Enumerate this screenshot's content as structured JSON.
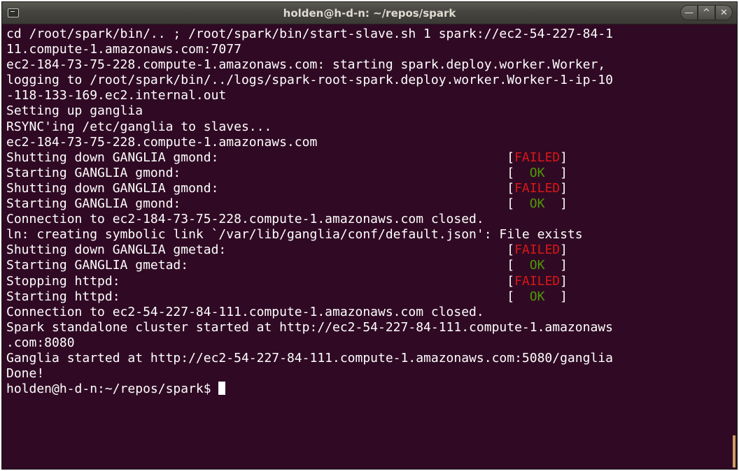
{
  "window": {
    "title": "holden@h-d-n: ~/repos/spark",
    "minimize_glyph": "—",
    "maximize_glyph": "^",
    "close_glyph": "✕"
  },
  "terminal": {
    "lines": [
      "cd /root/spark/bin/.. ; /root/spark/bin/start-slave.sh 1 spark://ec2-54-227-84-1",
      "11.compute-1.amazonaws.com:7077",
      "ec2-184-73-75-228.compute-1.amazonaws.com: starting spark.deploy.worker.Worker,",
      "logging to /root/spark/bin/../logs/spark-root-spark.deploy.worker.Worker-1-ip-10",
      "-118-133-169.ec2.internal.out",
      "Setting up ganglia",
      "RSYNC'ing /etc/ganglia to slaves...",
      "ec2-184-73-75-228.compute-1.amazonaws.com",
      "Shutting down GANGLIA gmond:",
      "Starting GANGLIA gmond:",
      "Shutting down GANGLIA gmond:",
      "Starting GANGLIA gmond:",
      "Connection to ec2-184-73-75-228.compute-1.amazonaws.com closed.",
      "ln: creating symbolic link `/var/lib/ganglia/conf/default.json': File exists",
      "Shutting down GANGLIA gmetad:",
      "Starting GANGLIA gmetad:",
      "Stopping httpd:",
      "Starting httpd:",
      "Connection to ec2-54-227-84-111.compute-1.amazonaws.com closed.",
      "Spark standalone cluster started at http://ec2-54-227-84-111.compute-1.amazonaws",
      ".com:8080",
      "Ganglia started at http://ec2-54-227-84-111.compute-1.amazonaws.com:5080/ganglia",
      "Done!"
    ],
    "statuses": {
      "8": "FAILED",
      "9": "OK",
      "10": "FAILED",
      "11": "OK",
      "14": "FAILED",
      "15": "OK",
      "16": "FAILED",
      "17": "OK"
    },
    "status_column": 66,
    "prompt": "holden@h-d-n:~/repos/spark$ ",
    "colors": {
      "background": "#300a24",
      "foreground": "#ffffff",
      "failed": "#d81717",
      "ok": "#4e9a06"
    }
  }
}
